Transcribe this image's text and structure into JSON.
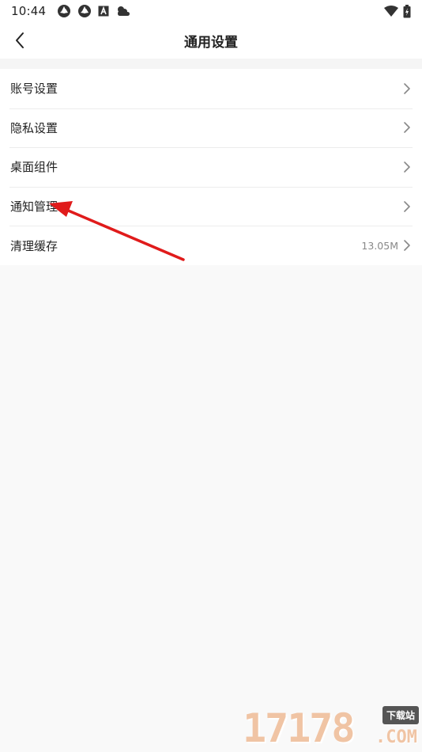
{
  "status_bar": {
    "time": "10:44",
    "left_icons": [
      "aperture-icon",
      "aperture-icon",
      "a-box-icon",
      "weather-cloud-icon"
    ],
    "right_icons": [
      "wifi-icon",
      "battery-icon"
    ]
  },
  "header": {
    "title": "通用设置",
    "back_icon": "chevron-left-icon"
  },
  "settings": {
    "items": [
      {
        "label": "账号设置",
        "value": ""
      },
      {
        "label": "隐私设置",
        "value": ""
      },
      {
        "label": "桌面组件",
        "value": ""
      },
      {
        "label": "通知管理",
        "value": ""
      },
      {
        "label": "清理缓存",
        "value": "13.05M"
      }
    ]
  },
  "annotation": {
    "color": "#e01b1b",
    "icon": "red-arrow-icon"
  },
  "watermark": {
    "digits": "17178",
    "badge": "下载站",
    "suffix": ".COM"
  }
}
